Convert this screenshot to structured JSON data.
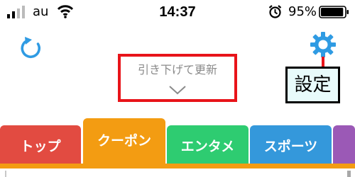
{
  "status_bar": {
    "carrier": "au",
    "time": "14:37",
    "battery_percent": "95%",
    "battery_level": 0.95,
    "icons": [
      "signal-icon",
      "wifi-icon",
      "alarm-icon",
      "battery-icon"
    ]
  },
  "header": {
    "refresh_icon": "refresh-icon",
    "settings_icon": "gear-icon",
    "pull_to_refresh_text": "引き下げて更新",
    "pull_indicator_icon": "chevron-down-icon",
    "settings_callout": "設定"
  },
  "tabs": [
    {
      "label": "トップ",
      "color": "#e24b41",
      "selected": false
    },
    {
      "label": "クーポン",
      "color": "#f39c12",
      "selected": true
    },
    {
      "label": "エンタメ",
      "color": "#2ecc71",
      "selected": false
    },
    {
      "label": "スポーツ",
      "color": "#3498db",
      "selected": false
    },
    {
      "label": "",
      "color": "#9b59b6",
      "selected": false
    }
  ],
  "colors": {
    "accent_icon": "#2f9be3",
    "annotation_red": "#e8141a",
    "selected_tab_underline": "#f39c12"
  }
}
